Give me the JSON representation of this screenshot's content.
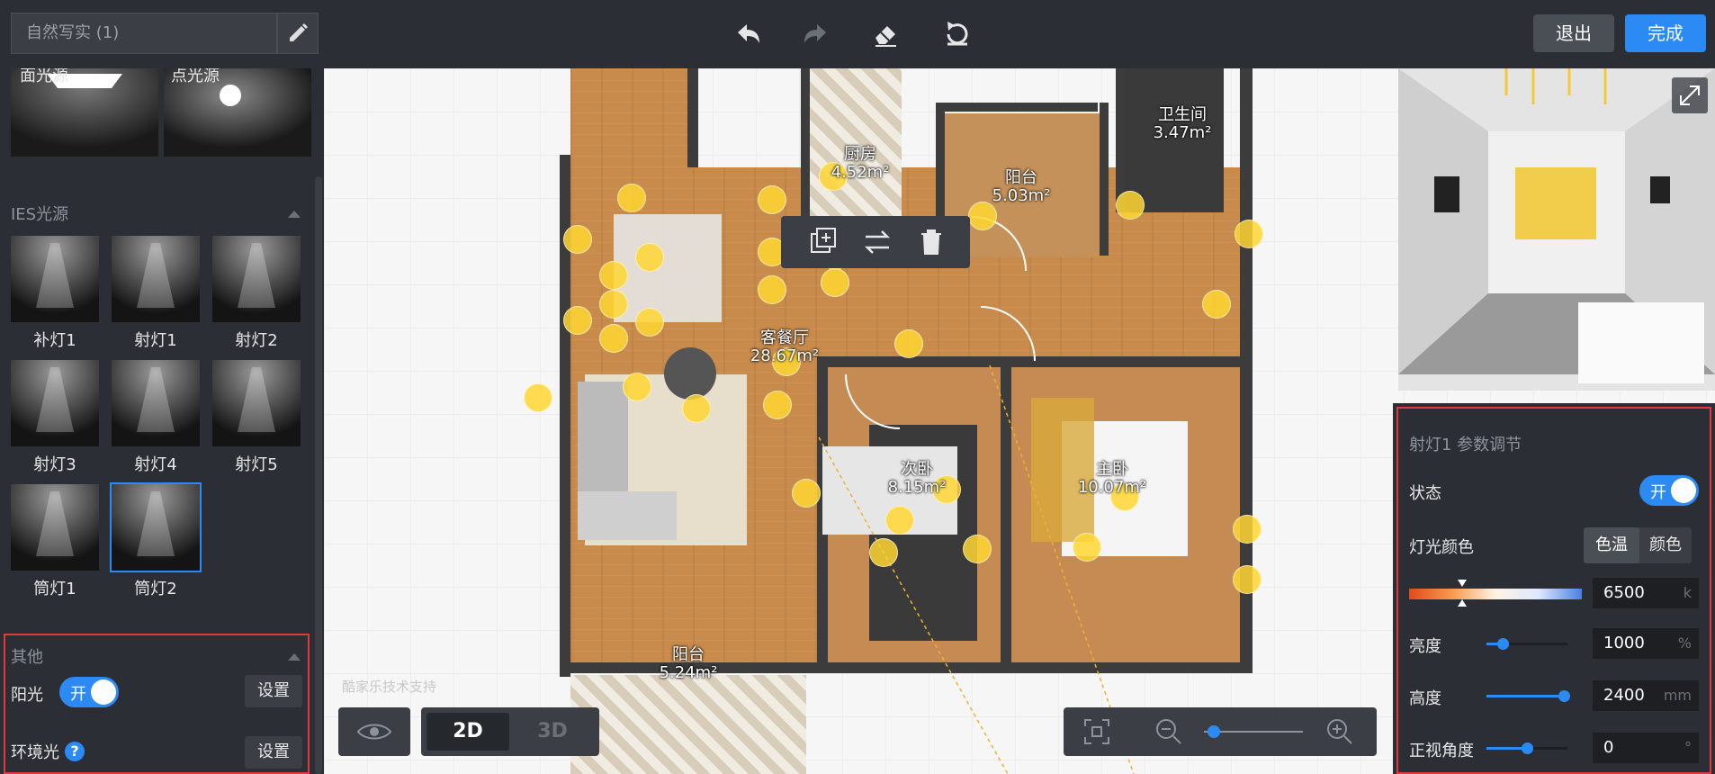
{
  "header": {
    "scheme_name": "自然写实 (1)",
    "exit_label": "退出",
    "done_label": "完成"
  },
  "left_panel": {
    "area_lights": [
      {
        "label": "面光源"
      },
      {
        "label": "点光源"
      }
    ],
    "ies_section_title": "IES光源",
    "ies_lights": [
      {
        "label": "补灯1"
      },
      {
        "label": "射灯1"
      },
      {
        "label": "射灯2"
      },
      {
        "label": "射灯3"
      },
      {
        "label": "射灯4"
      },
      {
        "label": "射灯5"
      },
      {
        "label": "筒灯1"
      },
      {
        "label": "筒灯2"
      }
    ],
    "selected_ies": "筒灯2",
    "other_section": {
      "title": "其他",
      "sunlight_label": "阳光",
      "sunlight_toggle": "开",
      "sunlight_on": true,
      "sunlight_settings": "设置",
      "ambient_label": "环境光",
      "ambient_settings": "设置"
    }
  },
  "floorplan": {
    "rooms": [
      {
        "name": "厨房",
        "area": "4.52m²"
      },
      {
        "name": "阳台",
        "area": "5.03m²"
      },
      {
        "name": "卫生间",
        "area": "3.47m²"
      },
      {
        "name": "客餐厅",
        "area": "28.67m²"
      },
      {
        "name": "次卧",
        "area": "8.15m²"
      },
      {
        "name": "主卧",
        "area": "10.07m²"
      },
      {
        "name": "阳台",
        "area": "5.24m²"
      }
    ],
    "watermark": "酷家乐技术支持"
  },
  "view_controls": {
    "mode_2d": "2D",
    "mode_3d": "3D",
    "active_mode": "2D",
    "zoom_level": 0.1
  },
  "params": {
    "title": "射灯1 参数调节",
    "state_label": "状态",
    "state_toggle": "开",
    "state_on": true,
    "color_label": "灯光颜色",
    "color_tab_temp": "色温",
    "color_tab_color": "颜色",
    "color_temp_value": "6500",
    "color_temp_unit": "k",
    "brightness_label": "亮度",
    "brightness_value": "1000",
    "brightness_unit": "%",
    "brightness_level": 0.2,
    "height_label": "高度",
    "height_value": "2400",
    "height_unit": "mm",
    "height_level": 0.95,
    "angle_label": "正视角度",
    "angle_value": "0",
    "angle_unit": "°",
    "angle_level": 0.5
  },
  "colors": {
    "accent": "#2c8af5",
    "panel": "#2b2f35",
    "highlight_box": "#e0393d",
    "light_bulb": "#ffd633"
  }
}
